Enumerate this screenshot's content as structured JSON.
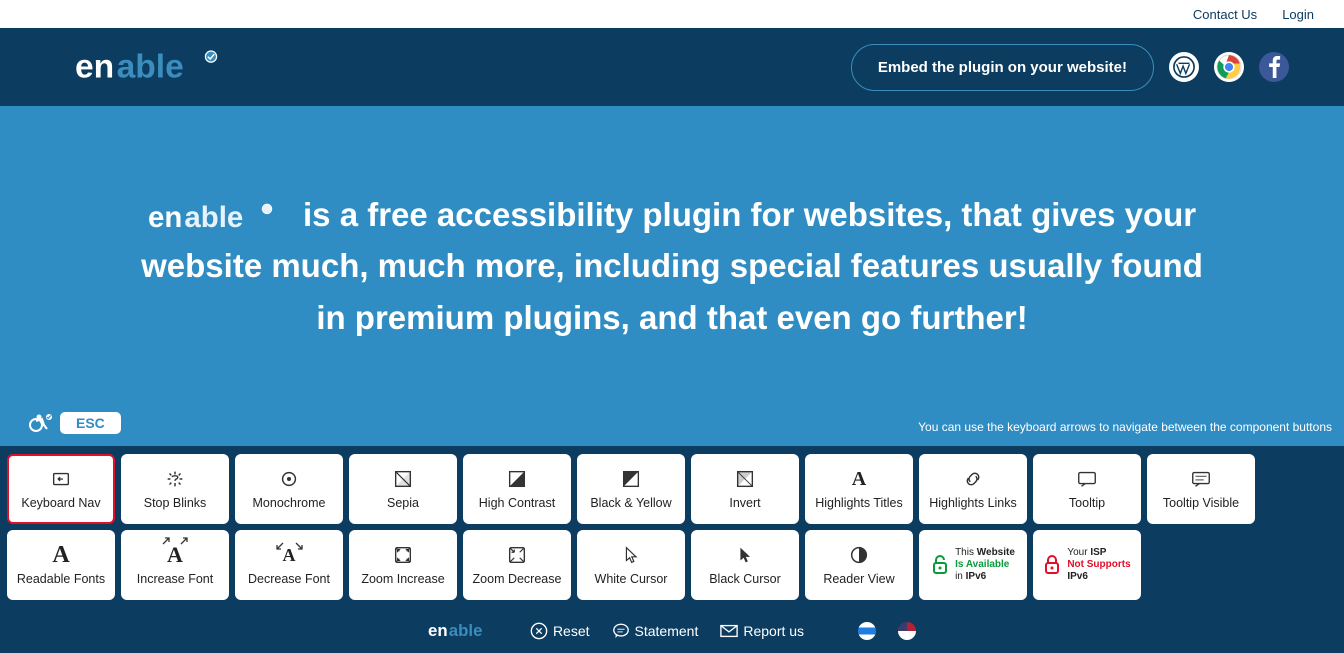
{
  "topnav": {
    "contact": "Contact Us",
    "login": "Login"
  },
  "header": {
    "logo_text": "enable",
    "embed": "Embed the plugin on your website!"
  },
  "hero": {
    "tagline": "is a free accessibility plugin for websites, that gives your website much, much more, including special features usually found in premium plugins, and that even go further!",
    "hint": "You can use the keyboard arrows to navigate between the component buttons",
    "esc": "ESC"
  },
  "tiles_row1": [
    {
      "id": "keyboard-nav",
      "label": "Keyboard Nav",
      "active": true
    },
    {
      "id": "stop-blinks",
      "label": "Stop Blinks"
    },
    {
      "id": "monochrome",
      "label": "Monochrome"
    },
    {
      "id": "sepia",
      "label": "Sepia"
    },
    {
      "id": "high-contrast",
      "label": "High Contrast"
    },
    {
      "id": "black-yellow",
      "label": "Black & Yellow"
    },
    {
      "id": "invert",
      "label": "Invert"
    },
    {
      "id": "highlights-titles",
      "label": "Highlights Titles"
    },
    {
      "id": "highlights-links",
      "label": "Highlights Links"
    },
    {
      "id": "tooltip",
      "label": "Tooltip"
    },
    {
      "id": "tooltip-visible",
      "label": "Tooltip Visible"
    }
  ],
  "tiles_row2": [
    {
      "id": "readable-fonts",
      "label": "Readable Fonts"
    },
    {
      "id": "increase-font",
      "label": "Increase Font"
    },
    {
      "id": "decrease-font",
      "label": "Decrease Font"
    },
    {
      "id": "zoom-increase",
      "label": "Zoom Increase"
    },
    {
      "id": "zoom-decrease",
      "label": "Zoom Decrease"
    },
    {
      "id": "white-cursor",
      "label": "White Cursor"
    },
    {
      "id": "black-cursor",
      "label": "Black Cursor"
    },
    {
      "id": "reader-view",
      "label": "Reader View"
    }
  ],
  "ipv6_good": {
    "line1": "This",
    "line1b": "Website",
    "line2": "Is Available",
    "line3": "in",
    "line3b": "IPv6"
  },
  "ipv6_bad": {
    "line1": "Your",
    "line1b": "ISP",
    "line2": "Not Supports",
    "line3": "IPv6"
  },
  "footer": {
    "logo": "enable",
    "reset": "Reset",
    "statement": "Statement",
    "report": "Report us"
  }
}
